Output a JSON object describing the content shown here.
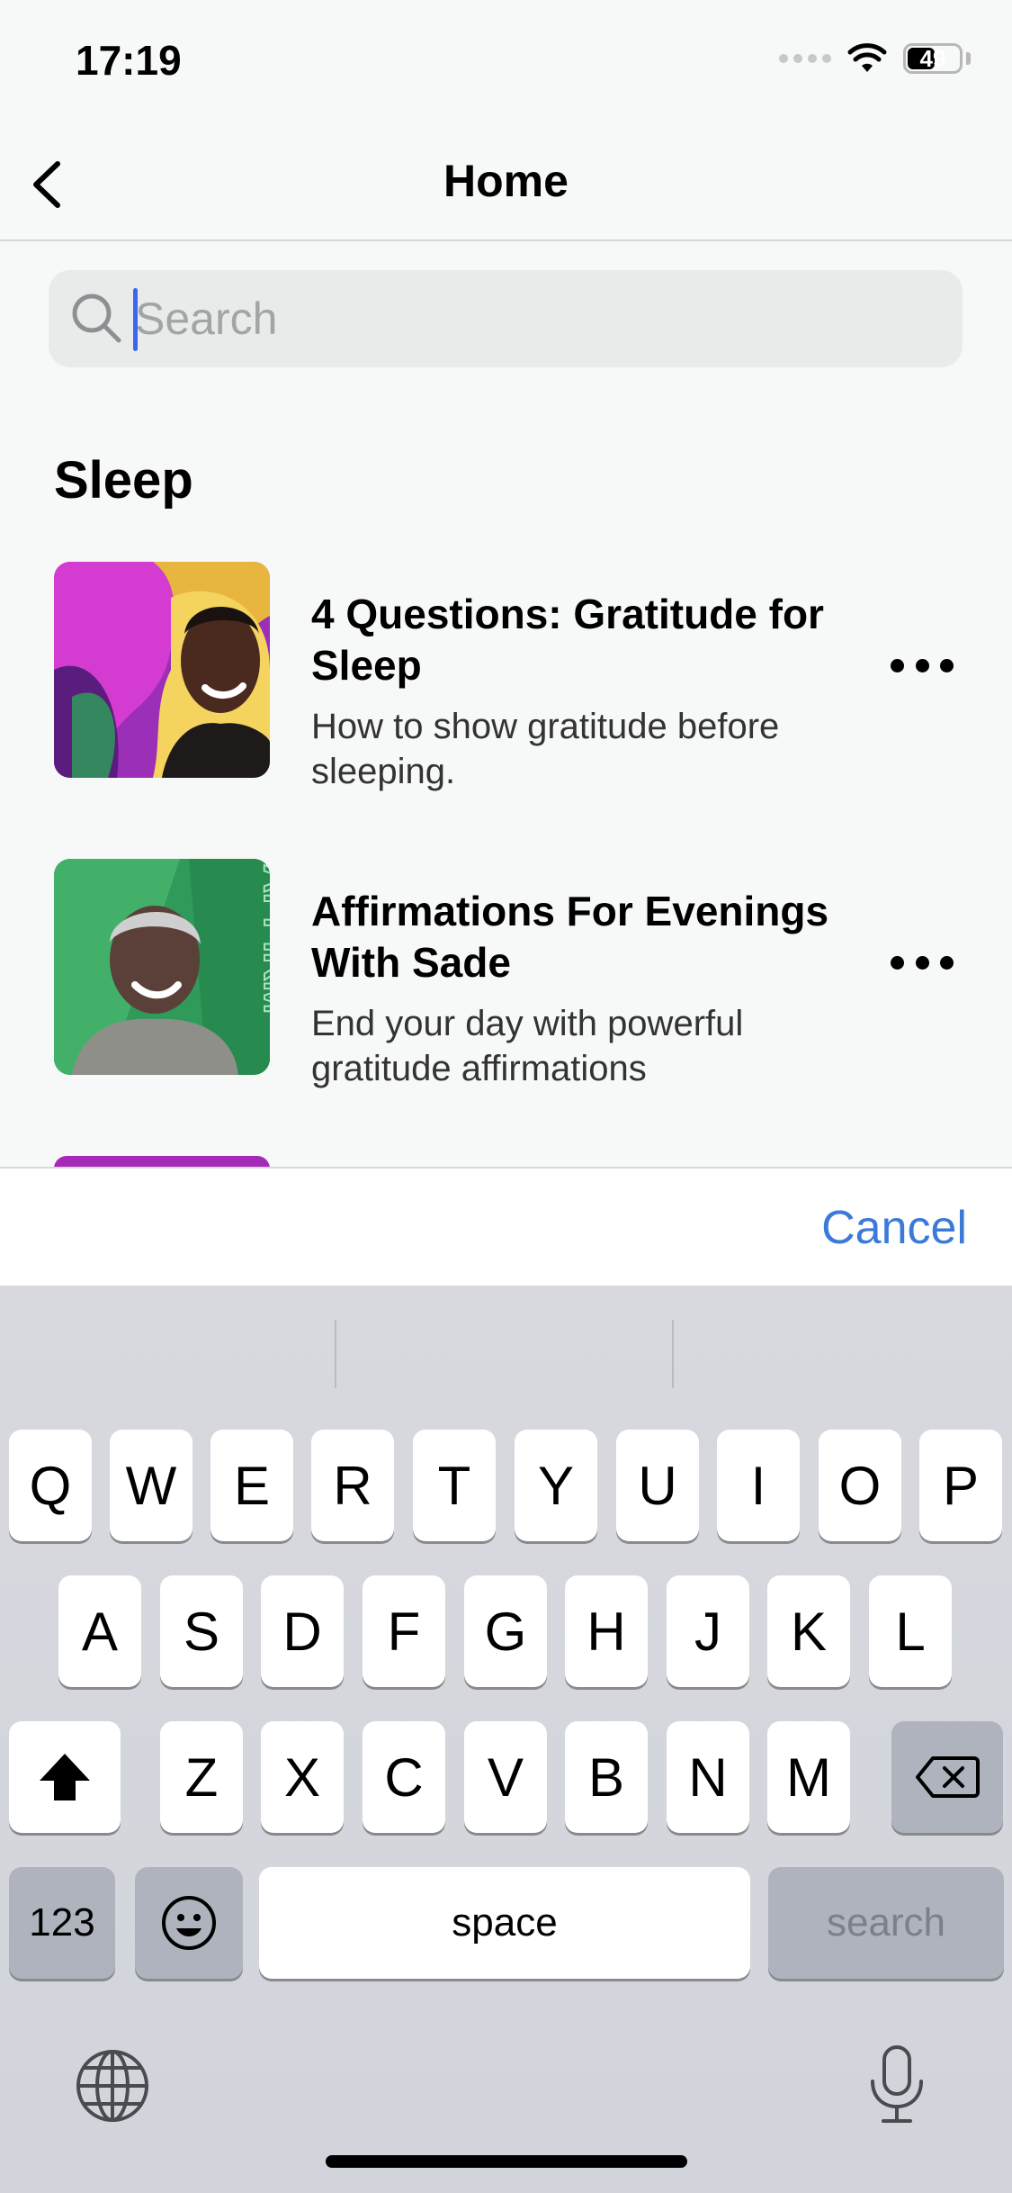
{
  "status_bar": {
    "time": "17:19",
    "battery": "49"
  },
  "nav": {
    "title": "Home"
  },
  "search": {
    "placeholder": "Search"
  },
  "section": {
    "title": "Sleep",
    "items": [
      {
        "title": "4 Questions: Gratitude for Sleep",
        "subtitle": "How to show gratitude before sleeping."
      },
      {
        "title": "Affirmations For Evenings With Sade",
        "subtitle": "End your day with powerful gratitude affirmations",
        "thumb_text": "AFFIRM"
      }
    ]
  },
  "cancel_label": "Cancel",
  "keyboard": {
    "row1": [
      "Q",
      "W",
      "E",
      "R",
      "T",
      "Y",
      "U",
      "I",
      "O",
      "P"
    ],
    "row2": [
      "A",
      "S",
      "D",
      "F",
      "G",
      "H",
      "J",
      "K",
      "L"
    ],
    "row3": [
      "Z",
      "X",
      "C",
      "V",
      "B",
      "N",
      "M"
    ],
    "numbers_label": "123",
    "space_label": "space",
    "search_label": "search"
  },
  "colors": {
    "accent": "#3b7ad9",
    "caret": "#3a67f0"
  }
}
